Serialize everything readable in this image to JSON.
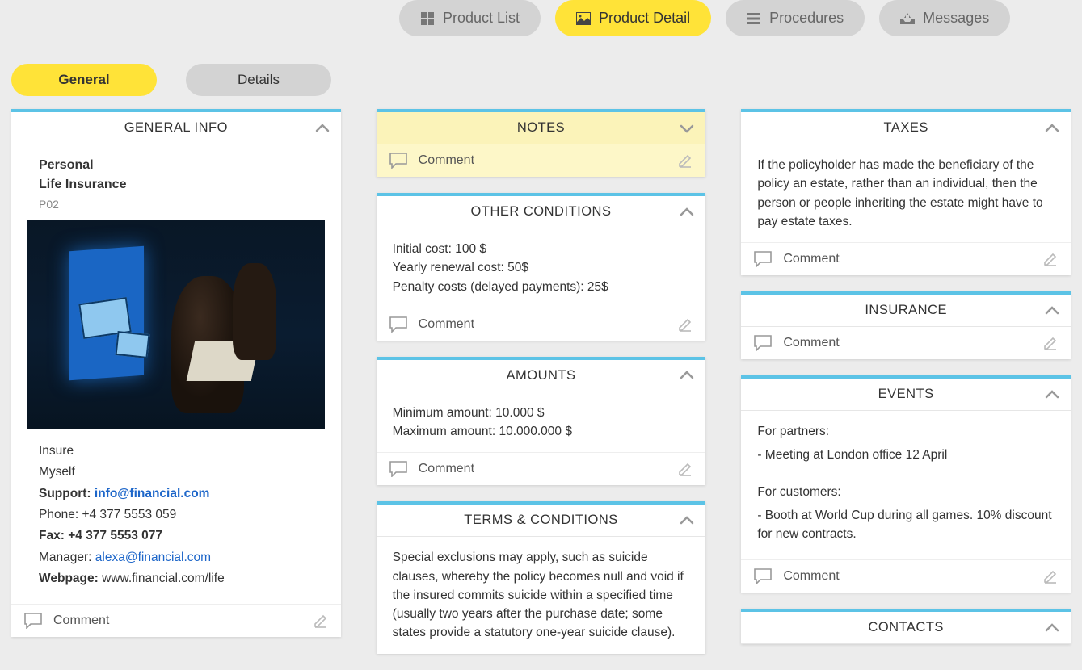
{
  "topnav": {
    "items": [
      {
        "label": "Product List",
        "active": false,
        "icon": "grid-icon"
      },
      {
        "label": "Product Detail",
        "active": true,
        "icon": "image-icon"
      },
      {
        "label": "Procedures",
        "active": false,
        "icon": "list-icon"
      },
      {
        "label": "Messages",
        "active": false,
        "icon": "inbox-icon"
      }
    ]
  },
  "subtabs": {
    "items": [
      {
        "label": "General",
        "active": true
      },
      {
        "label": "Details",
        "active": false
      }
    ]
  },
  "cards": {
    "general_info": {
      "title": "GENERAL INFO",
      "product_line1": "Personal",
      "product_line2": "Life Insurance",
      "code": "P02",
      "company_line1": "Insure",
      "company_line2": "Myself",
      "support_label": "Support:",
      "support_email": "info@financial.com",
      "phone_label": "Phone: ",
      "phone_value": "+4 377 5553 059",
      "fax_label": "Fax: ",
      "fax_value": "+4 377 5553 077",
      "manager_label": "Manager: ",
      "manager_email": "alexa@financial.com",
      "webpage_label": "Webpage:",
      "webpage_value": "www.financial.com/life",
      "comment_label": "Comment"
    },
    "notes": {
      "title": "NOTES",
      "comment_label": "Comment"
    },
    "other_conditions": {
      "title": "OTHER CONDITIONS",
      "line1": "Initial cost: 100 $",
      "line2": "Yearly renewal cost: 50$",
      "line3": "Penalty costs (delayed payments): 25$",
      "comment_label": "Comment"
    },
    "amounts": {
      "title": "AMOUNTS",
      "line1": "Minimum amount: 10.000 $",
      "line2": "Maximum amount: 10.000.000 $",
      "comment_label": "Comment"
    },
    "terms": {
      "title": "TERMS & CONDITIONS",
      "body": "Special exclusions may apply, such as suicide clauses, whereby the policy becomes null and void if the insured commits suicide within a specified time (usually two years after the purchase date; some states provide a statutory one-year suicide clause)."
    },
    "taxes": {
      "title": "TAXES",
      "body": "If the policyholder has made the beneficiary of the policy an estate, rather than an individual, then the person or people inheriting the estate might have to pay estate taxes.",
      "comment_label": "Comment"
    },
    "insurance": {
      "title": "INSURANCE",
      "comment_label": "Comment"
    },
    "events": {
      "title": "EVENTS",
      "partners_heading": "For partners:",
      "partners_line": "- Meeting at London office 12 April",
      "customers_heading": "For customers:",
      "customers_line": "- Booth at World Cup during all games. 10% discount for new contracts.",
      "comment_label": "Comment"
    },
    "contacts": {
      "title": "CONTACTS"
    }
  }
}
